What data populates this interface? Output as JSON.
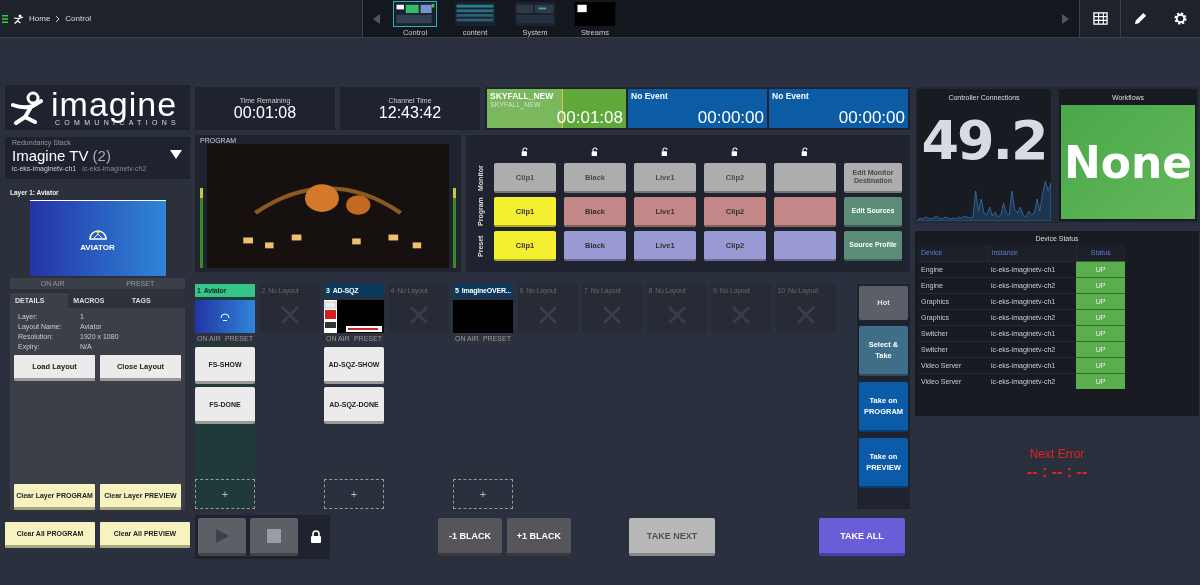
{
  "breadcrumb": [
    "Home",
    "Control"
  ],
  "screens": [
    {
      "label": "Control",
      "kind": "control",
      "selected": true
    },
    {
      "label": "content",
      "kind": "content",
      "selected": false
    },
    {
      "label": "System",
      "kind": "system",
      "selected": false
    },
    {
      "label": "Streams",
      "kind": "streams",
      "selected": false
    }
  ],
  "logo": {
    "name": "imagine",
    "tagline": "COMMUNICATIONS"
  },
  "redundancy": {
    "label": "Redundancy Stack",
    "name": "Imagine TV",
    "count": "(2)",
    "instances": [
      {
        "name": "ic-eks-imaginetv-ch1",
        "selected": true
      },
      {
        "name": "ic-eks-imaginetv-ch2",
        "selected": false
      }
    ]
  },
  "layer": {
    "title": "Layer 1: Aviator",
    "thumbnail_text": "AVIATOR",
    "status_labels": [
      "ON AIR",
      "PRESET"
    ],
    "tabs": [
      {
        "label": "DETAILS",
        "selected": true
      },
      {
        "label": "MACROS",
        "selected": false
      },
      {
        "label": "TAGS",
        "selected": false
      }
    ],
    "details": [
      {
        "key": "Layer:",
        "value": "1"
      },
      {
        "key": "Layout Name:",
        "value": "Aviator"
      },
      {
        "key": "Resolution:",
        "value": "1920 x 1080"
      },
      {
        "key": "Expiry:",
        "value": "N/A"
      }
    ],
    "buttons": [
      "Load Layout",
      "Close Layout"
    ],
    "clear_buttons": [
      "Clear Layer PROGRAM",
      "Clear Layer PREVIEW"
    ]
  },
  "clear_all": [
    "Clear All PROGRAM",
    "Clear All PREVIEW"
  ],
  "clocks": [
    {
      "label": "Time Remaining",
      "value": "00:01:08"
    },
    {
      "label": "Channel Time",
      "value": "12:43:42"
    }
  ],
  "events": [
    {
      "title": "SKYFALL_NEW",
      "subtitle": "SKYFALL_NEW",
      "time": "00:01:08",
      "color": "#5fa83a",
      "level": 0.55
    },
    {
      "title": "No Event",
      "time": "00:00:00",
      "color": "#0b5ca5"
    },
    {
      "title": "No Event",
      "time": "00:00:00",
      "color": "#0b5ca5"
    }
  ],
  "preview": {
    "label": "PROGRAM"
  },
  "router": {
    "locks": [
      {
        "locked": false
      },
      {
        "locked": false
      },
      {
        "locked": false
      },
      {
        "locked": false
      },
      {
        "locked": false
      }
    ],
    "rows": [
      {
        "label": "Monitor",
        "kind": "monitor",
        "cells": [
          {
            "label": "Clip1",
            "selected": false
          },
          {
            "label": "Black",
            "selected": false
          },
          {
            "label": "Live1",
            "selected": false
          },
          {
            "label": "Clip2",
            "selected": false
          },
          {
            "selected": false
          }
        ]
      },
      {
        "label": "Program",
        "kind": "program",
        "cells": [
          {
            "label": "Clip1",
            "selected": true
          },
          {
            "label": "Black",
            "selected": false
          },
          {
            "label": "Live1",
            "selected": false
          },
          {
            "label": "Clip2",
            "selected": false
          },
          {
            "selected": false
          }
        ]
      },
      {
        "label": "Preset",
        "kind": "preset",
        "cells": [
          {
            "label": "Clip1",
            "selected": true
          },
          {
            "label": "Black",
            "selected": false
          },
          {
            "label": "Live1",
            "selected": false
          },
          {
            "label": "Clip2",
            "selected": false
          },
          {
            "selected": false
          }
        ]
      }
    ],
    "actions": [
      {
        "label": "Edit Monitor Destination",
        "disabled": true
      },
      {
        "label": "Edit Sources",
        "disabled": false
      },
      {
        "label": "Source Profile",
        "disabled": false
      }
    ]
  },
  "layouts": [
    {
      "number": "1",
      "name": "Aviator",
      "kind": "loaded",
      "thumbnail": {
        "kind": "aviator"
      },
      "selected": true,
      "status_labels": [
        "ON AIR",
        "PRESET"
      ],
      "macros": [
        "FS-SHOW",
        "FS-DONE"
      ],
      "add_label": "+"
    },
    {
      "number": "2",
      "name": "No Layout",
      "kind": "empty",
      "selected": false
    },
    {
      "number": "3",
      "name": "AD-SQZ",
      "kind": "loaded",
      "thumbnail": {
        "kind": "squeeze"
      },
      "selected": false,
      "status_labels": [
        "ON AIR",
        "PRESET"
      ],
      "macros": [
        "AD-SQZ-SHOW",
        "AD-SQZ-DONE"
      ],
      "add_label": "+"
    },
    {
      "number": "4",
      "name": "No Layout",
      "kind": "empty",
      "selected": false
    },
    {
      "number": "5",
      "name": "ImagineOVER...",
      "kind": "loaded",
      "thumbnail": {
        "kind": "black"
      },
      "selected": false,
      "status_labels": [
        "ON AIR",
        "PRESET"
      ],
      "add_label": "+"
    },
    {
      "number": "6",
      "name": "No Layout",
      "kind": "empty",
      "selected": false
    },
    {
      "number": "7",
      "name": "No Layout",
      "kind": "empty",
      "selected": false
    },
    {
      "number": "8",
      "name": "No Layout",
      "kind": "empty",
      "selected": false
    },
    {
      "number": "9",
      "name": "No Layout",
      "kind": "empty",
      "selected": false
    },
    {
      "number": "10",
      "name": "No Layout",
      "kind": "empty",
      "selected": false
    }
  ],
  "layout_actions": [
    {
      "label": "Hot",
      "kind": "hot"
    },
    {
      "label": "Select & Take",
      "kind": "select"
    },
    {
      "label": "Take on PROGRAM",
      "kind": "take"
    },
    {
      "label": "Take on PREVIEW",
      "kind": "take"
    }
  ],
  "transport": {
    "locked": true,
    "take_next": {
      "label": "TAKE NEXT",
      "disabled": true
    },
    "take_all": {
      "label": "TAKE ALL",
      "disabled": false
    },
    "black_buttons": [
      "-1 BLACK",
      "+1 BLACK"
    ]
  },
  "controller": {
    "title": "Controller Connections",
    "value": "49.2"
  },
  "workflows": {
    "title": "Workflows",
    "value": "None"
  },
  "device_status": {
    "title": "Device Status",
    "columns": [
      "Device",
      "Instance",
      "Status"
    ],
    "rows": [
      {
        "device": "Engine",
        "instance": "ic-eks-imaginetv-ch1",
        "status": "UP"
      },
      {
        "device": "Engine",
        "instance": "ic-eks-imaginetv-ch2",
        "status": "UP"
      },
      {
        "device": "Graphics",
        "instance": "ic-eks-imaginetv-ch1",
        "status": "UP"
      },
      {
        "device": "Graphics",
        "instance": "ic-eks-imaginetv-ch2",
        "status": "UP"
      },
      {
        "device": "Switcher",
        "instance": "ic-eks-imaginetv-ch1",
        "status": "UP"
      },
      {
        "device": "Switcher",
        "instance": "ic-eks-imaginetv-ch2",
        "status": "UP"
      },
      {
        "device": "Video Server",
        "instance": "ic-eks-imaginetv-ch1",
        "status": "UP"
      },
      {
        "device": "Video Server",
        "instance": "ic-eks-imaginetv-ch2",
        "status": "UP"
      }
    ]
  },
  "next_error": {
    "label": "Next Error",
    "value": "-- : -- : --"
  }
}
